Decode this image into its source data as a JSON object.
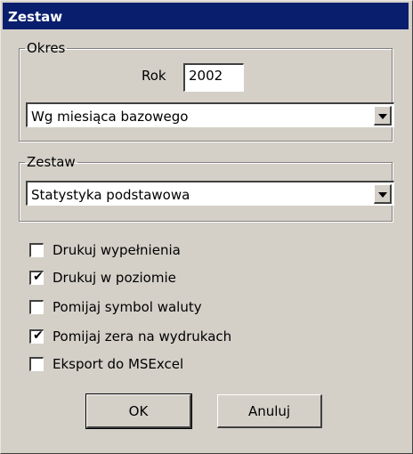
{
  "window": {
    "title": "Zestaw"
  },
  "okres": {
    "legend": "Okres",
    "rok_label": "Rok",
    "rok_value": "2002",
    "mode_selected": "Wg miesiąca bazowego"
  },
  "zestaw": {
    "legend": "Zestaw",
    "selected": "Statystyka podstawowa"
  },
  "options": [
    {
      "label": "Drukuj wypełnienia",
      "checked": false
    },
    {
      "label": "Drukuj w poziomie",
      "checked": true
    },
    {
      "label": "Pomijaj symbol waluty",
      "checked": false
    },
    {
      "label": "Pomijaj zera na wydrukach",
      "checked": true
    },
    {
      "label": "Eksport do MSExcel",
      "checked": false
    }
  ],
  "buttons": {
    "ok": "OK",
    "cancel": "Anuluj"
  }
}
